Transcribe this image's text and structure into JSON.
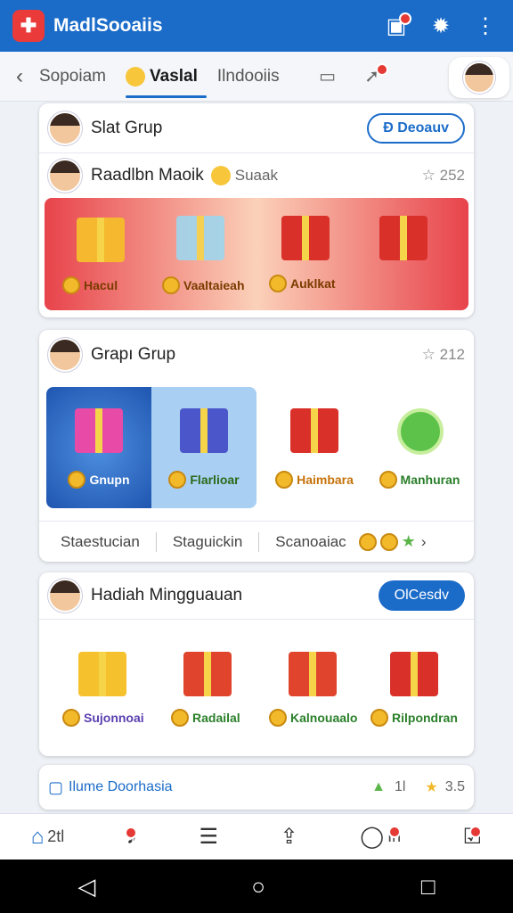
{
  "app": {
    "title": "MadlSooaiis",
    "logo": "✚"
  },
  "appbar_icons": [
    {
      "name": "notification-icon",
      "glyph": "▣"
    },
    {
      "name": "gear-icon",
      "glyph": "✹"
    },
    {
      "name": "more-icon",
      "glyph": "⋮"
    }
  ],
  "tabs": {
    "back": "‹",
    "items": [
      "Sopoiam",
      "Vaslal",
      "Ilndooiis"
    ]
  },
  "cards": {
    "slat": {
      "name": "Slat Grup",
      "button": "Ð Deoauv"
    },
    "raadlon": {
      "name": "Raadlbn Maoik",
      "tag": "Suaak",
      "stat": "☆ 252",
      "labels": [
        "Hacul",
        "Vaaltaieah",
        "Auklkat"
      ]
    },
    "grapi": {
      "name": "Grapı Grup",
      "stat": "☆ 212",
      "tiles": [
        "Gnupn",
        "Flarlioar",
        "Haimbara",
        "Manhuran"
      ],
      "subtabs": [
        "Staestucian",
        "Staguickin",
        "Scanoaiac"
      ]
    },
    "hadiah": {
      "name": "Hadiah Mingguauan",
      "button": "OlCesdv",
      "labels": [
        "Sujonnoai",
        "Radailal",
        "Kalnouaalo",
        "Rilpondran"
      ]
    },
    "footer": {
      "text": "Ilume Doorhasia",
      "count1": "1l",
      "count2": "3.5"
    }
  },
  "bottomnav": [
    {
      "name": "home",
      "label": "2tl"
    },
    {
      "name": "notif",
      "label": ""
    },
    {
      "name": "list",
      "label": ""
    },
    {
      "name": "share",
      "label": ""
    },
    {
      "name": "chat",
      "label": "Irl"
    },
    {
      "name": "inbox",
      "label": ""
    }
  ],
  "colors": {
    "primary": "#1b6cc9",
    "accent": "#ea3a3a"
  }
}
